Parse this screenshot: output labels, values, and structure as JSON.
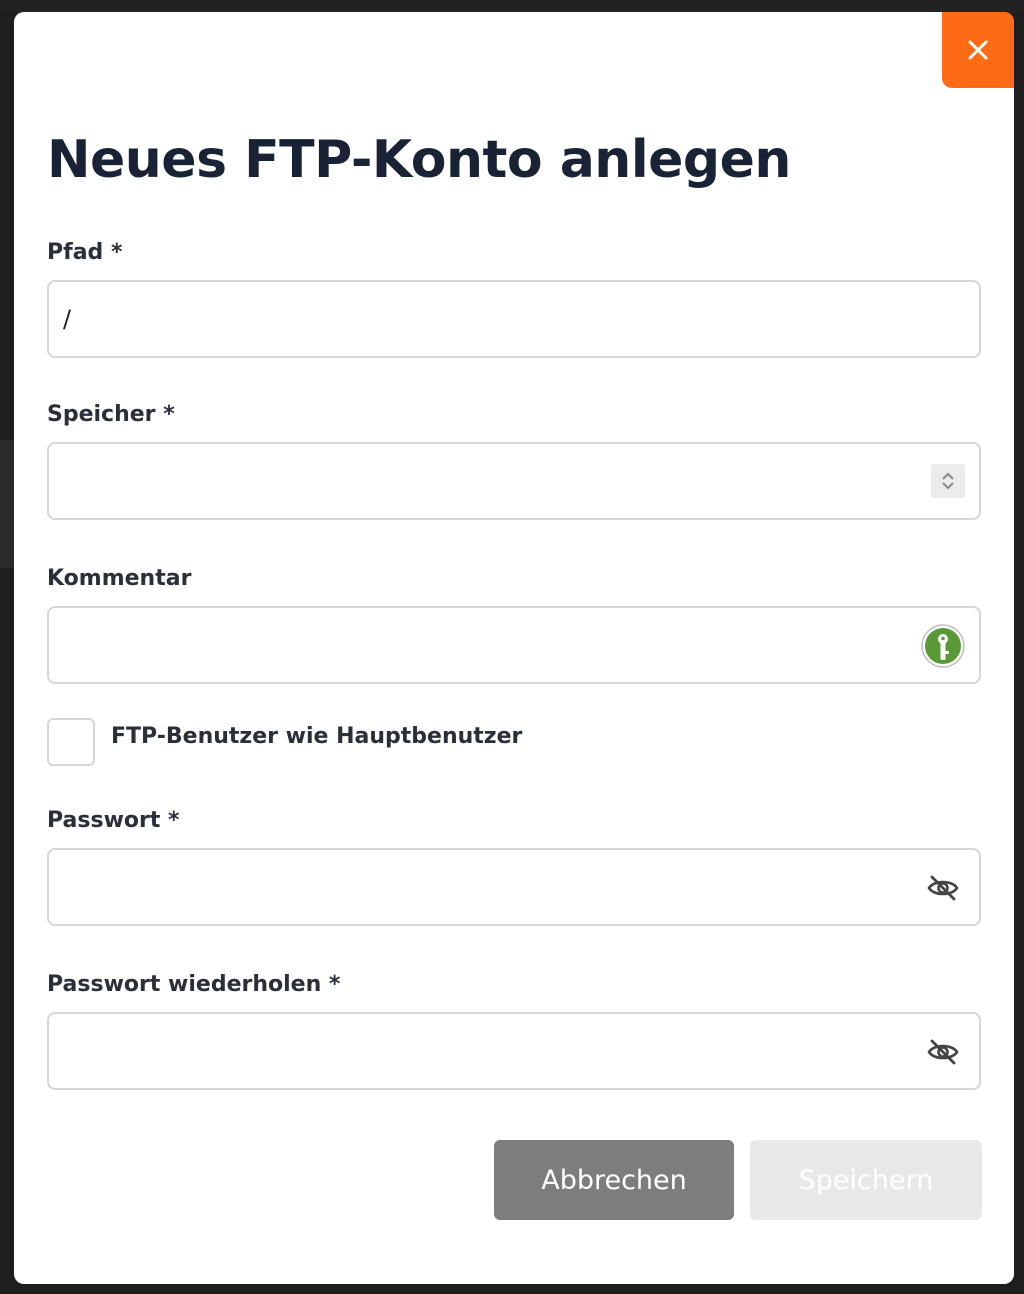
{
  "dialog": {
    "title": "Neues FTP-Konto anlegen",
    "close_icon": "close-icon",
    "accent_color": "#ff6a14"
  },
  "fields": {
    "path": {
      "label": "Pfad *",
      "value": "/"
    },
    "storage": {
      "label": "Speicher *",
      "value": ""
    },
    "comment": {
      "label": "Kommentar",
      "value": ""
    },
    "same_user_checkbox": {
      "label": "FTP-Benutzer wie Hauptbenutzer",
      "checked": false
    },
    "password": {
      "label": "Passwort *",
      "value": ""
    },
    "password_repeat": {
      "label": "Passwort wiederholen *",
      "value": ""
    }
  },
  "icons": {
    "storage_spinner": "number-stepper-icon",
    "comment_addon": "password-manager-key-icon",
    "password_toggle": "eye-slash-icon"
  },
  "buttons": {
    "cancel_label": "Abbrechen",
    "save_label": "Speichern"
  }
}
